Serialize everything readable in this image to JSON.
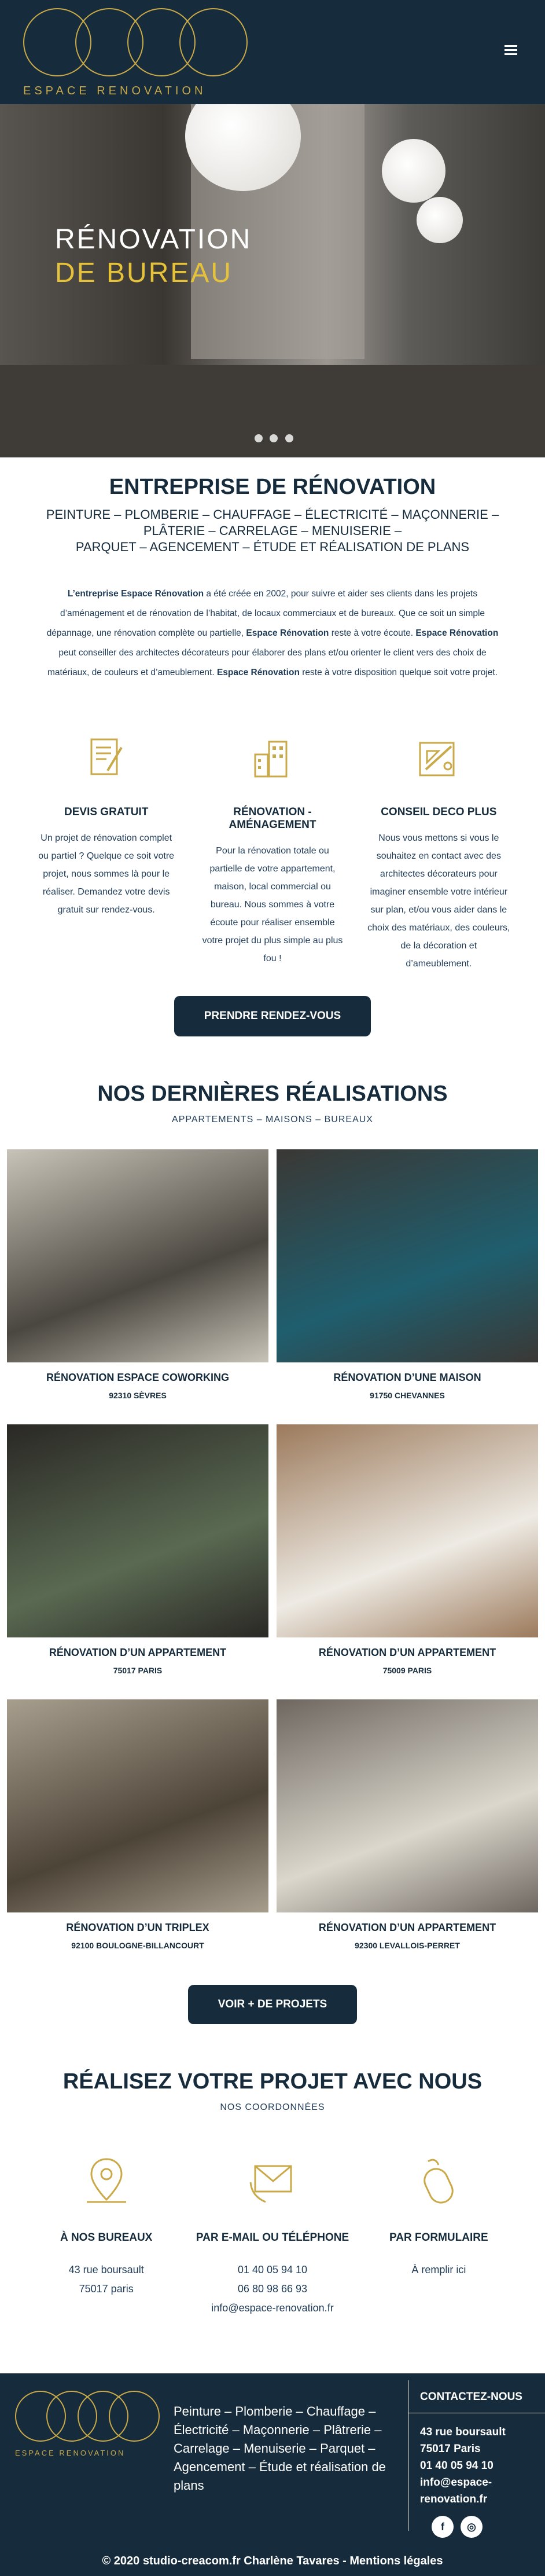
{
  "header": {
    "logo_text": "ESPACE RENOVATION",
    "menu_icon": "hamburger-icon"
  },
  "hero": {
    "title_line1": "RÉNOVATION",
    "title_line2": "DE BUREAU"
  },
  "intro": {
    "title": "ENTREPRISE DE RÉNOVATION",
    "services_line1": "PEINTURE – PLOMBERIE – CHAUFFAGE – ÉLECTRICITÉ – MAÇONNERIE –",
    "services_line2": "PLÂTERIE – CARRELAGE – MENUISERIE –",
    "services_line3": "PARQUET – AGENCEMENT – ÉTUDE ET RÉALISATION DE PLANS",
    "paragraph_1_bold": "L’entreprise Espace Rénovation",
    "paragraph_1": " a été créée en 2002, pour suivre et aider ses clients dans les projets d’aménagement et de rénovation de l’habitat, de locaux commerciaux et de bureaux. Que ce soit un simple dépannage, une rénovation complète ou partielle, ",
    "paragraph_2_bold": "Espace Rénovation",
    "paragraph_2": " reste à votre écoute. ",
    "paragraph_3_bold": "Espace Rénovation",
    "paragraph_3": " peut conseiller des architectes décorateurs pour élaborer des plans et/ou orienter le client vers des choix de matériaux, de couleurs et d’ameublement. ",
    "paragraph_4_bold": "Espace Rénovation",
    "paragraph_4": " reste à votre disposition quelque soit votre projet."
  },
  "services": [
    {
      "icon": "document-pen-icon",
      "title": "DEVIS GRATUIT",
      "text": "Un projet de rénovation complet ou partiel ? Quelque ce soit votre projet, nous sommes là pour le réaliser. Demandez votre devis gratuit sur rendez-vous."
    },
    {
      "icon": "buildings-icon",
      "title": "RÉNOVATION - AMÉNAGEMENT",
      "text": "Pour la rénovation totale ou partielle de votre appartement, maison, local commercial ou bureau. Nous sommes à votre écoute pour réaliser ensemble votre projet du plus simple au plus fou !"
    },
    {
      "icon": "tools-icon",
      "title": "CONSEIL DECO PLUS",
      "text": "Nous vous mettons si vous le souhaitez en contact avec des architectes décorateurs pour imaginer ensemble votre intérieur sur plan, et/ou vous aider dans le choix des matériaux, des couleurs, de la décoration et d’ameublement."
    }
  ],
  "appointment_button": "PRENDRE RENDEZ-VOUS",
  "realisations": {
    "title": "NOS DERNIÈRES RÉALISATIONS",
    "subtitle": "APPARTEMENTS – MAISONS – BUREAUX",
    "items": [
      {
        "caption": "RÉNOVATION ESPACE COWORKING",
        "location": "92310 SÈVRES",
        "c1": "#4a4740",
        "c2": "#c8c3b8"
      },
      {
        "caption": "RÉNOVATION D’UNE MAISON",
        "location": "91750 CHEVANNES",
        "c1": "#1f5e6e",
        "c2": "#3a3835"
      },
      {
        "caption": "RÉNOVATION D’UN APPARTEMENT",
        "location": "75017 PARIS",
        "c1": "#5a6a52",
        "c2": "#2a2825"
      },
      {
        "caption": "RÉNOVATION D’UN APPARTEMENT",
        "location": "75009 PARIS",
        "c1": "#eeebe4",
        "c2": "#9c7a5c"
      },
      {
        "caption": "RÉNOVATION D’UN TRIPLEX",
        "location": "92100 BOULOGNE-BILLANCOURT",
        "c1": "#4d4438",
        "c2": "#a89e8e"
      },
      {
        "caption": "RÉNOVATION D’UN APPARTEMENT",
        "location": "92300 LEVALLOIS-PERRET",
        "c1": "#dcd7cd",
        "c2": "#6d6760"
      }
    ]
  },
  "more_projects_button": "VOIR + DE PROJETS",
  "contact": {
    "title": "RÉALISEZ VOTRE PROJET AVEC NOUS",
    "subtitle": "NOS COORDONNÉES",
    "office": {
      "icon": "map-pin-icon",
      "title": "À NOS BUREAUX",
      "line1": "43 rue boursault",
      "line2": "75017 paris"
    },
    "email": {
      "icon": "envelope-phone-icon",
      "title": "PAR E-MAIL OU TÉLÉPHONE",
      "phone1": "01 40 05 94 10",
      "phone2": "06 80 98 66 93",
      "email": "info@espace-renovation.fr"
    },
    "form": {
      "icon": "mouse-icon",
      "title": "PAR FORMULAIRE",
      "text": "À remplir ici"
    }
  },
  "footer": {
    "logo_text": "ESPACE RENOVATION",
    "services": "Peinture – Plomberie – Chauffage – Électricité – Maçonnerie – Plâtrerie – Carrelage – Menuiserie – Parquet – Agencement – Étude et réalisation de plans",
    "contact_title": "CONTACTEZ-NOUS",
    "address1": "43 rue boursault",
    "address2": "75017 Paris",
    "phone": "01 40 05 94 10",
    "email": "info@espace-renovation.fr",
    "facebook": "f",
    "instagram": "◎",
    "copyright": "© 2020 studio-creacom.fr Charlène Tavares - Mentions légales"
  },
  "colors": {
    "navy": "#162c3c",
    "gold": "#c9a948",
    "hero_gold": "#e6c23a"
  }
}
